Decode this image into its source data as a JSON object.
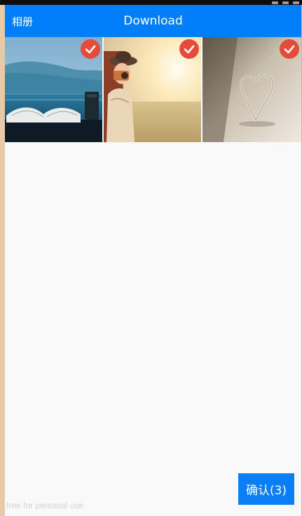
{
  "appbar": {
    "back_label": "相册",
    "title": "Download"
  },
  "photos": [
    {
      "subject": "open book by the sea",
      "selected": true
    },
    {
      "subject": "girl with camera at sunset",
      "selected": true
    },
    {
      "subject": "glass heart",
      "selected": true
    }
  ],
  "confirm_label": "确认(3)",
  "watermark": "free for personal use",
  "colors": {
    "appbar": "#007ff9",
    "check_badge": "#e64a3b",
    "confirm_button": "#0a7ff5",
    "background": "#f9f9f9"
  },
  "icons": {
    "selected": "checkmark-icon"
  }
}
